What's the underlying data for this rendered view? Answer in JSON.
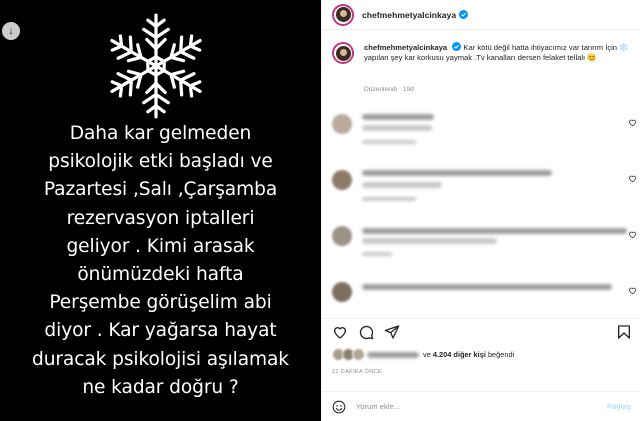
{
  "story": {
    "text": "Daha kar gelmeden\npsikolojik etki başladı ve\nPazartesi ,Salı ,Çarşamba\nrezervasyon iptalleri\ngeliyor  . Kimi arasak\nönümüzdeki hafta\nPerşembe görüşelim abi\ndiyor . Kar yağarsa hayat\nduracak psikolojisi aşılamak\nne kadar doğru ?",
    "download_icon": "download-icon",
    "decoration_icon": "snowflake-icon"
  },
  "header": {
    "username": "chefmehmetyalcinkaya",
    "verified_icon": "verified-badge-icon"
  },
  "caption": {
    "username": "chefmehmetyalcinkaya",
    "text": "Kar kötü değil hatta ihtiyacımız var tanrım İçin ❄️ yapılan şey kar korkusu yaymak .Tv kanalları dersen felaket tellalı 😊",
    "meta": "Düzenlendi · 19d"
  },
  "actions": {
    "like_icon": "heart-icon",
    "comment_icon": "comment-icon",
    "share_icon": "share-icon",
    "save_icon": "bookmark-icon"
  },
  "likes": {
    "prefix": "ve",
    "count_text": "4.204 diğer kişi",
    "suffix": "beğendi"
  },
  "time_ago": "21 DAKİKA ÖNCE",
  "add_comment": {
    "placeholder": "Yorum ekle...",
    "post_label": "Paylaş",
    "emoji_icon": "emoji-icon"
  },
  "colors": {
    "verified": "#0095f6",
    "avatar_ring": "#c13584",
    "post_button_disabled": "#b2dffc",
    "muted": "#8e8e8e"
  }
}
